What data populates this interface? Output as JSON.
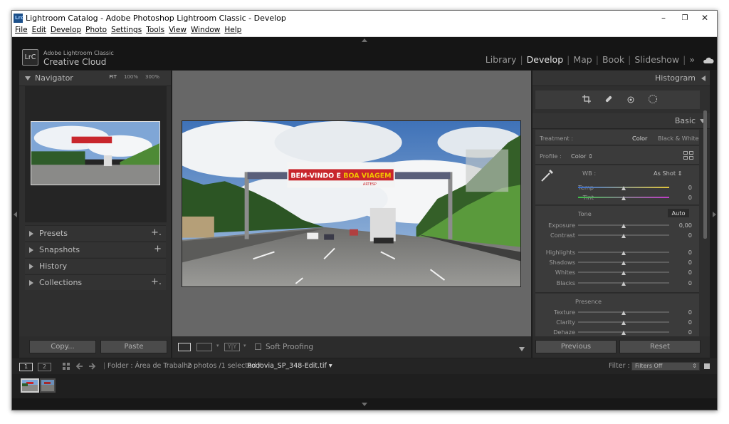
{
  "window": {
    "title": "Lightroom Catalog - Adobe Photoshop Lightroom Classic - Develop",
    "app_icon_text": "Lrc",
    "controls": {
      "minimize": "–",
      "maximize": "❐",
      "close": "✕"
    }
  },
  "menubar": [
    "File",
    "Edit",
    "Develop",
    "Photo",
    "Settings",
    "Tools",
    "View",
    "Window",
    "Help"
  ],
  "identity": {
    "logo": "LrC",
    "line1": "Adobe Lightroom Classic",
    "line2": "Creative Cloud"
  },
  "modules": {
    "items": [
      "Library",
      "Develop",
      "Map",
      "Book",
      "Slideshow"
    ],
    "active": "Develop",
    "more": "»"
  },
  "left_panel": {
    "navigator": {
      "title": "Navigator",
      "zoom": [
        "FIT",
        "100%",
        "300%"
      ]
    },
    "sections": [
      {
        "label": "Presets",
        "plus": "+."
      },
      {
        "label": "Snapshots",
        "plus": "+"
      },
      {
        "label": "History",
        "plus": ""
      },
      {
        "label": "Collections",
        "plus": "+."
      }
    ],
    "copy_label": "Copy...",
    "paste_label": "Paste"
  },
  "photo": {
    "sign_main": "BEM-VINDO E BOA VIAGEM",
    "sign_accent": "BOA VIAGEM",
    "sign_brand": "ARTESP"
  },
  "toolbar": {
    "soft_proofing": "Soft Proofing",
    "yy": "Y|Y"
  },
  "right_panel": {
    "histogram_title": "Histogram",
    "basic_title": "Basic",
    "treatment_label": "Treatment :",
    "treatment_options": [
      "Color",
      "Black & White"
    ],
    "profile_label": "Profile :",
    "profile_value": "Color",
    "wb_label": "WB :",
    "wb_value": "As Shot",
    "tone_title": "Tone",
    "auto_label": "Auto",
    "presence_title": "Presence",
    "sliders": {
      "temp": {
        "label": "Temp",
        "value": "0"
      },
      "tint": {
        "label": "Tint",
        "value": "0"
      },
      "exposure": {
        "label": "Exposure",
        "value": "0,00"
      },
      "contrast": {
        "label": "Contrast",
        "value": "0"
      },
      "highlights": {
        "label": "Highlights",
        "value": "0"
      },
      "shadows": {
        "label": "Shadows",
        "value": "0"
      },
      "whites": {
        "label": "Whites",
        "value": "0"
      },
      "blacks": {
        "label": "Blacks",
        "value": "0"
      },
      "texture": {
        "label": "Texture",
        "value": "0"
      },
      "clarity": {
        "label": "Clarity",
        "value": "0"
      },
      "dehaze": {
        "label": "Dehaze",
        "value": "0"
      }
    },
    "previous_label": "Previous",
    "reset_label": "Reset"
  },
  "filmstrip_bar": {
    "screen1": "1",
    "screen2": "2",
    "folder": "Folder : Área de Trabalho",
    "count": "2 photos /1 selected /",
    "filename": "Rodovia_SP_348-Edit.tif",
    "filter_label": "Filter :",
    "filter_value": "Filters Off"
  },
  "colors": {
    "accent_red": "#c8262c",
    "accent_yellow": "#f2c200",
    "panel_bg": "#2f2f2f",
    "active_module": "#e6e6e6"
  }
}
